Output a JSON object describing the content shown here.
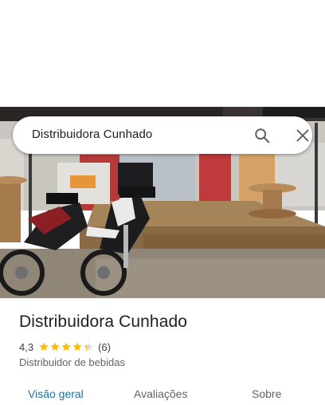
{
  "search": {
    "query": "Distribuidora Cunhado"
  },
  "place": {
    "name": "Distribuidora Cunhado",
    "rating": "4,3",
    "rating_value": 4.3,
    "review_count": "(6)",
    "category": "Distribuidor de bebidas"
  },
  "tabs": [
    {
      "label": "Visão geral",
      "active": true
    },
    {
      "label": "Avaliações",
      "active": false
    },
    {
      "label": "Sobre",
      "active": false
    }
  ],
  "colors": {
    "star": "#fbbc04",
    "accent": "#1a73a8"
  }
}
